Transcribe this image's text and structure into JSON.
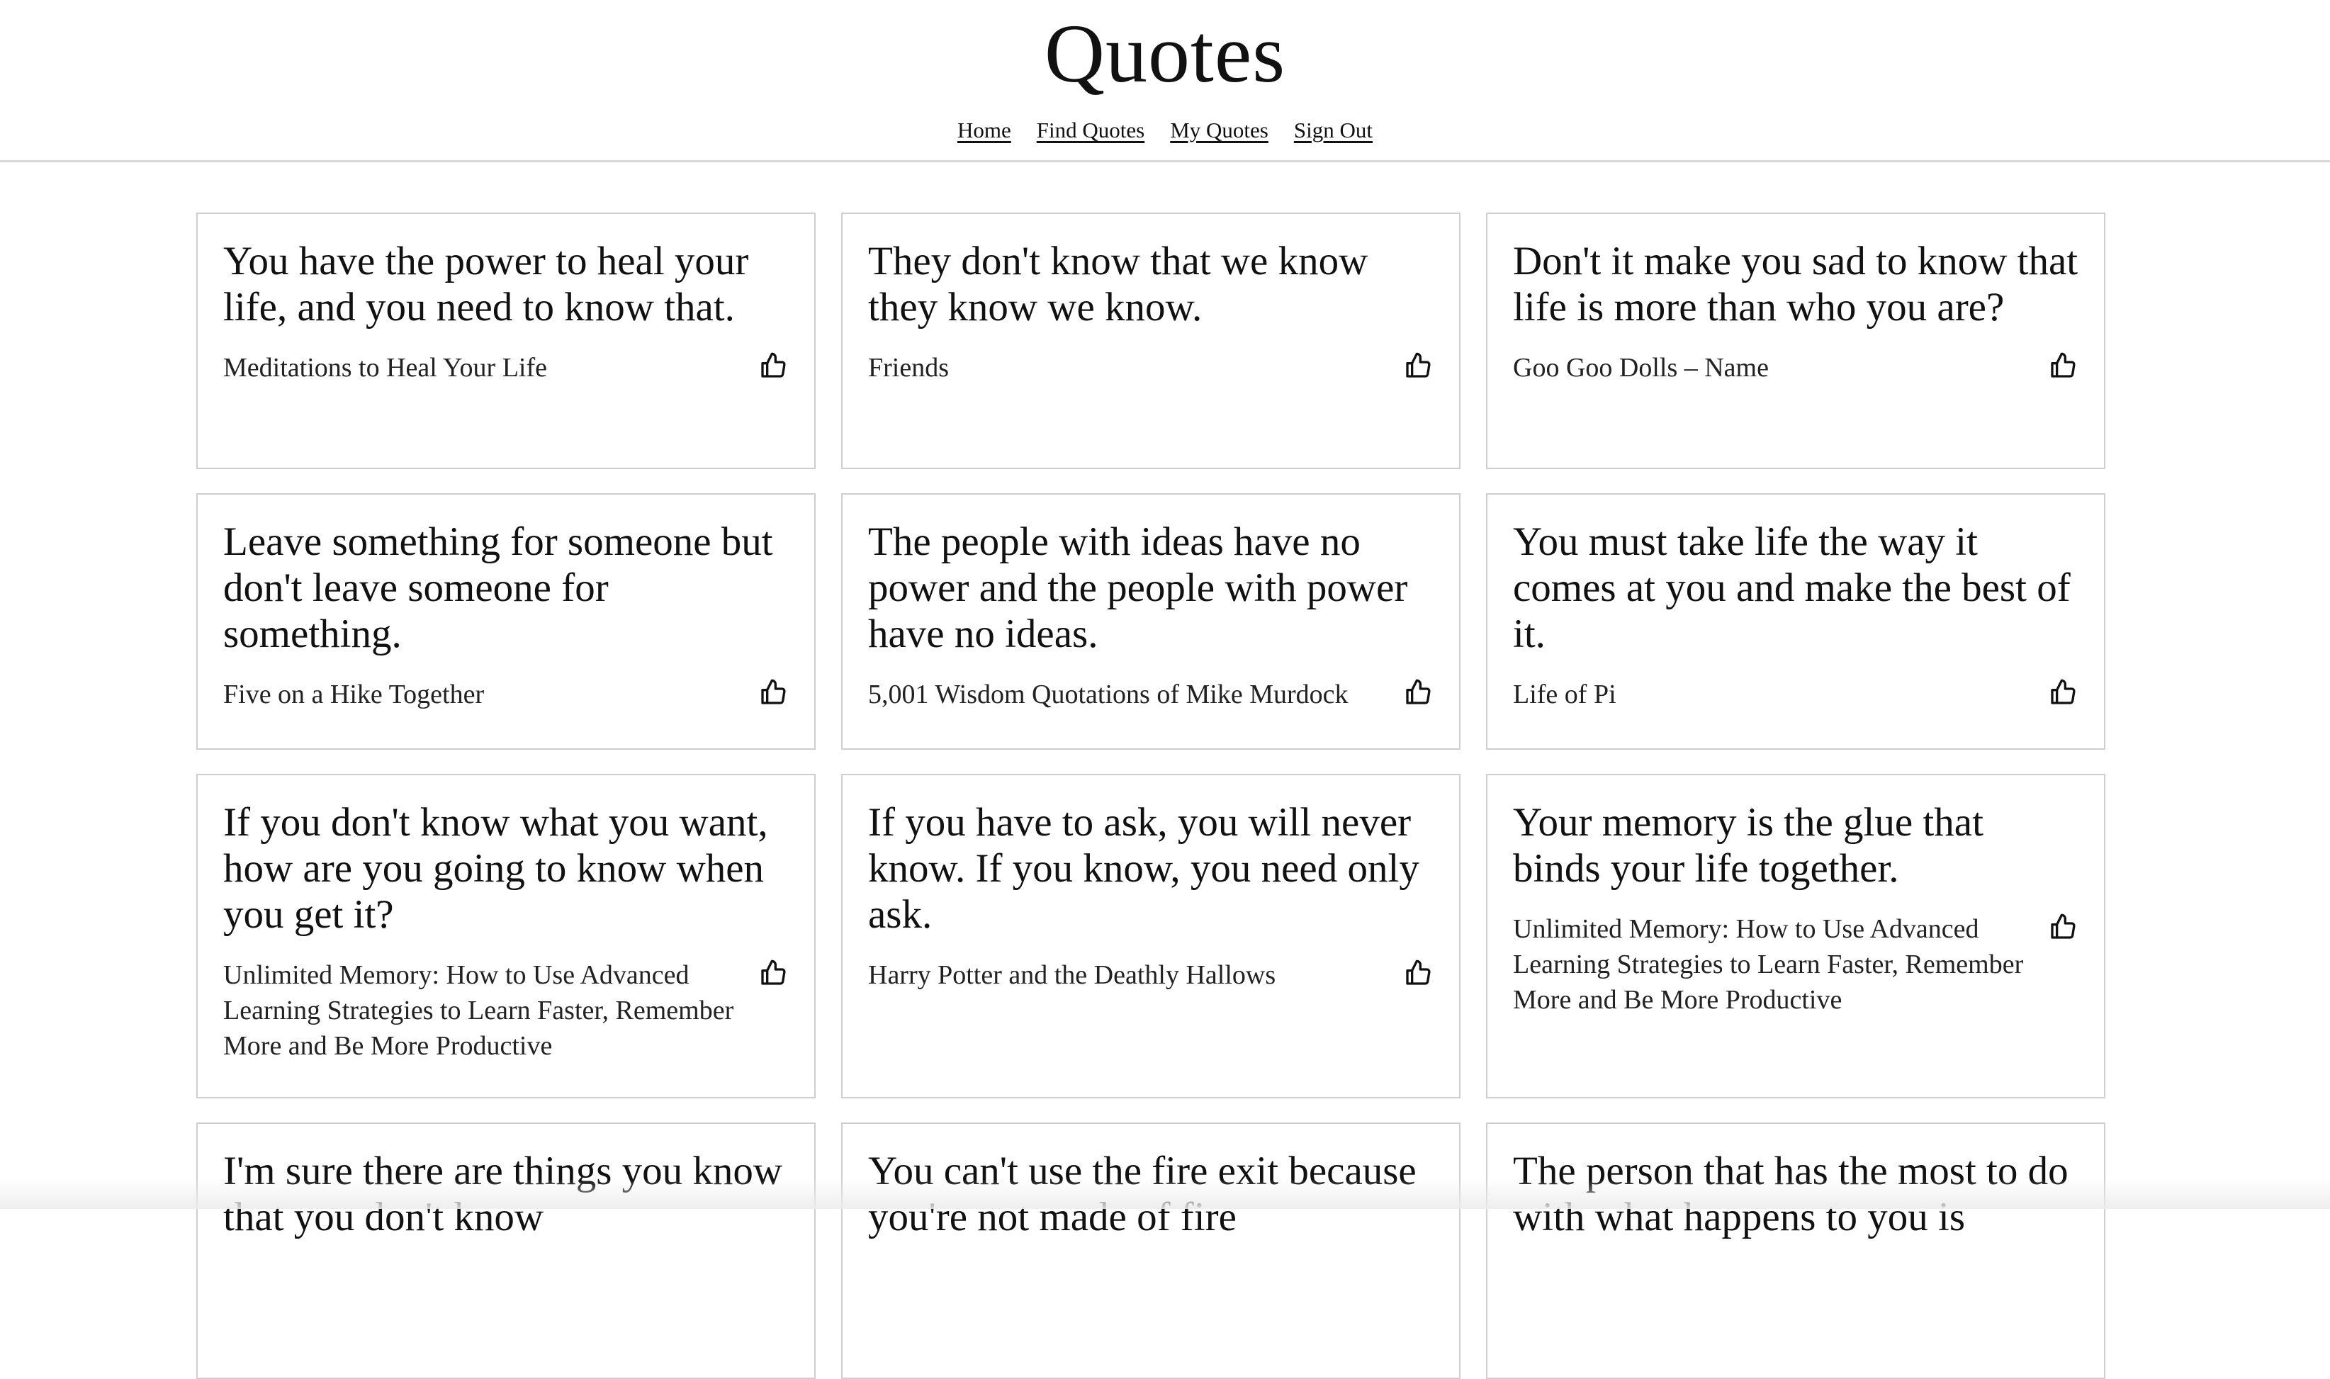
{
  "header": {
    "title": "Quotes",
    "nav": [
      "Home",
      "Find Quotes",
      "My Quotes",
      "Sign Out"
    ]
  },
  "quotes": [
    {
      "text": "You have the power to heal your life, and you need to know that.",
      "source": "Meditations to Heal Your Life"
    },
    {
      "text": "They don't know that we know they know we know.",
      "source": "Friends"
    },
    {
      "text": "Don't it make you sad to know that life is more than who you are?",
      "source": "Goo Goo Dolls – Name"
    },
    {
      "text": "Leave something for someone but don't leave someone for something.",
      "source": "Five on a Hike Together"
    },
    {
      "text": "The people with ideas have no power and the people with power have no ideas.",
      "source": "5,001 Wisdom Quotations of Mike Murdock"
    },
    {
      "text": "You must take life the way it comes at you and make the best of it.",
      "source": "Life of Pi"
    },
    {
      "text": "If you don't know what you want, how are you going to know when you get it?",
      "source": "Unlimited Memory: How to Use Advanced Learning Strategies to Learn Faster, Remember More and Be More Productive"
    },
    {
      "text": "If you have to ask, you will never know. If you know, you need only ask.",
      "source": "Harry Potter and the Deathly Hallows"
    },
    {
      "text": "Your memory is the glue that binds your life together.",
      "source": "Unlimited Memory: How to Use Advanced Learning Strategies to Learn Faster, Remember More and Be More Productive"
    },
    {
      "text": "I'm sure there are things you know that you don't know",
      "source": ""
    },
    {
      "text": "You can't use the fire exit because you're not made of fire",
      "source": ""
    },
    {
      "text": "The person that has the most to do with what happens to you is",
      "source": ""
    }
  ],
  "icons": {
    "like": "thumbs-up-icon"
  }
}
